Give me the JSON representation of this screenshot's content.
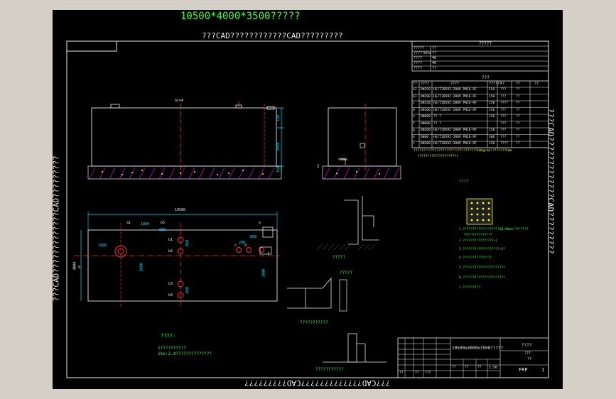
{
  "drawing": {
    "main_title": "10500*4000*3500?????",
    "frame_top_text": "???CAD????????????CAD?????????",
    "frame_left_text": "???CAD?????????????CAD?????????",
    "frame_right_text": "???CAD?????????????CAD?????????",
    "frame_bottom_text": "???CAD?????????????CAD?????????"
  },
  "params_table": {
    "title": "?????",
    "rows": [
      [
        "?????",
        "??"
      ],
      [
        "?????kPa",
        "??"
      ],
      [
        "????",
        "40"
      ],
      [
        "????",
        "40"
      ],
      [
        "????",
        "??"
      ]
    ]
  },
  "nozzle_table": {
    "title": "???",
    "header": [
      "??",
      "????",
      "????",
      "??????",
      "??",
      "??",
      "??"
    ],
    "rows": [
      [
        "a1",
        "DN250",
        "HG/T20592-2009 PN16-RF",
        "150",
        "???",
        "??"
      ],
      [
        "b1",
        "DN200",
        "HG/T20592-2009 PN16-RF",
        "150",
        "???",
        "??"
      ],
      [
        "c",
        "DN150",
        "HG/T20592-2009 PN16-RF",
        "150",
        "????",
        "??"
      ],
      [
        "d",
        "DN100",
        "HG/T20592-2009 PN16-RF",
        "150",
        "???",
        "??"
      ],
      [
        "e",
        "DN600",
        "?? ?",
        "150",
        "???",
        "??"
      ],
      [
        "f",
        "DN600",
        "?? ?",
        "",
        "???",
        "??"
      ],
      [
        "g",
        "DN200",
        "HG/T20592-2009 PN16-RF",
        "150",
        "???",
        "??"
      ],
      [
        "h",
        "DN80",
        "HG/T20592-2009 PN16-RF",
        "300",
        "???",
        "??"
      ],
      [
        "i",
        "DN200",
        "HG/T20592-2009 PN16-RF",
        "150",
        "????",
        "??"
      ]
    ],
    "note1": "?????????????????????????????????10kg/m2????????5mm",
    "note2": "?????????????????????"
  },
  "elevation": {
    "label_top": "b1=4",
    "dim_right1": "150",
    "dim_right2": "3500",
    "dim_bottom": "150"
  },
  "side_view": {
    "label": "2",
    "sub": "DN80"
  },
  "plan": {
    "overall_length": "10500",
    "width": "4000",
    "labels": [
      "a1",
      "b1",
      "b2",
      "b3",
      "b4",
      "b5",
      "c",
      "d",
      "e",
      "f",
      "g"
    ],
    "dims": [
      "1800",
      "850",
      "1500",
      "3000",
      "850",
      "850",
      "1000",
      "200",
      "800"
    ]
  },
  "details": {
    "detail1_title": "?????",
    "detail2_title": "?????",
    "detail3_title": "???????????",
    "detail4_title": "???????????"
  },
  "notes_right": {
    "title": "????",
    "lines": [
      "1.???????????????????60~90mm????????",
      "???????????????",
      "2.????????????????~2",
      "3.???????????????????~2?",
      "4.???????????????",
      "5.??????????????????????",
      "6.??????????????????????",
      "7.?????????"
    ]
  },
  "notes_left": {
    "title": "????:",
    "line1": "1??????????",
    "line2": "1%o:2.4??????????????"
  },
  "title_block": {
    "project": "10500x4000x3500?????",
    "col_labels": [
      "??",
      "??",
      "???",
      "??",
      "??",
      "??"
    ],
    "scale": "1:50",
    "sheet": "1",
    "material": "FRP",
    "right_title": "????",
    "right_sub1": "???",
    "right_sub2": "??"
  },
  "colors": {
    "background": "#000000",
    "frame": "#ffffff",
    "text_main": "#3cff3c",
    "dim": "#00e5ff",
    "centerline": "#ff2a2a",
    "hatch": "#ffff00",
    "outer": "#d4d0c8"
  }
}
